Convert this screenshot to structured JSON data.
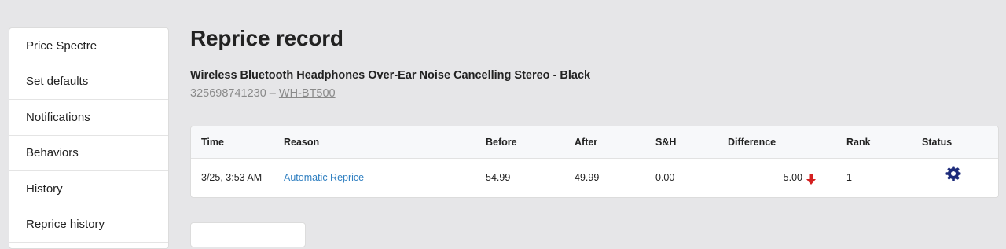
{
  "sidebar": {
    "items": [
      {
        "label": "Price Spectre"
      },
      {
        "label": "Set defaults"
      },
      {
        "label": "Notifications"
      },
      {
        "label": "Behaviors"
      },
      {
        "label": "History"
      },
      {
        "label": "Reprice history"
      }
    ]
  },
  "page": {
    "title": "Reprice record"
  },
  "product": {
    "name": "Wireless Bluetooth Headphones Over-Ear Noise Cancelling Stereo - Black",
    "item_id": "325698741230",
    "separator": " – ",
    "sku": "WH-BT500"
  },
  "table": {
    "headers": {
      "time": "Time",
      "reason": "Reason",
      "before": "Before",
      "after": "After",
      "sh": "S&H",
      "difference": "Difference",
      "rank": "Rank",
      "status": "Status"
    },
    "rows": [
      {
        "time": "3/25, 3:53 AM",
        "reason": "Automatic Reprice",
        "before": "54.99",
        "after": "49.99",
        "sh": "0.00",
        "difference": "-5.00",
        "rank": "1",
        "status_icon": "gear-badge-icon"
      }
    ]
  },
  "colors": {
    "link": "#2f7fc1",
    "down_arrow": "#d42020",
    "status_icon": "#1c2a7a"
  }
}
